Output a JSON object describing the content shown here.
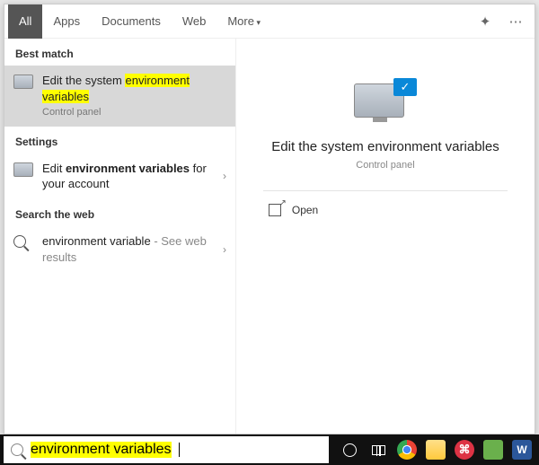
{
  "tabs": {
    "all": "All",
    "apps": "Apps",
    "documents": "Documents",
    "web": "Web",
    "more": "More"
  },
  "sections": {
    "best_match": "Best match",
    "settings": "Settings",
    "search_web": "Search the web"
  },
  "results": {
    "best": {
      "pre": "Edit the system ",
      "hl1": "environment",
      "hl2": "variables",
      "sub": "Control panel"
    },
    "setting": {
      "pre": "Edit ",
      "bold": "environment variables",
      "post": " for your account"
    },
    "web": {
      "query": "environment variable",
      "hint": "See web results"
    }
  },
  "preview": {
    "title": "Edit the system environment variables",
    "sub": "Control panel"
  },
  "actions": {
    "open": "Open"
  },
  "search": {
    "query": "environment variables"
  }
}
